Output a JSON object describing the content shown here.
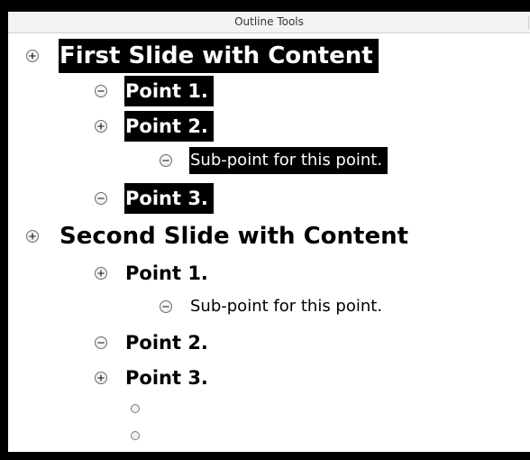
{
  "toolbar": {
    "title": "Outline Tools"
  },
  "outline": [
    {
      "text": "First Slide with Content",
      "level": 1,
      "toggle": "expand",
      "selected": true
    },
    {
      "text": "Point 1.",
      "level": 2,
      "toggle": "collapse",
      "selected": true
    },
    {
      "text": "Point 2.",
      "level": 2,
      "toggle": "expand",
      "selected": true
    },
    {
      "text": "Sub-point for this point.",
      "level": 3,
      "toggle": "collapse",
      "selected": true
    },
    {
      "text": "Point 3.",
      "level": 2,
      "toggle": "collapse",
      "selected": true
    },
    {
      "text": "Second Slide with Content",
      "level": 1,
      "toggle": "expand",
      "selected": false
    },
    {
      "text": "Point 1.",
      "level": 2,
      "toggle": "expand",
      "selected": false
    },
    {
      "text": "Sub-point for this point.",
      "level": 3,
      "toggle": "collapse",
      "selected": false
    },
    {
      "text": "Point 2.",
      "level": 2,
      "toggle": "collapse",
      "selected": false
    },
    {
      "text": "Point 3.",
      "level": 2,
      "toggle": "expand",
      "selected": false
    },
    {
      "text": "",
      "level": 3,
      "toggle": "empty",
      "selected": false
    },
    {
      "text": "",
      "level": 3,
      "toggle": "empty",
      "selected": false
    }
  ],
  "icons": {
    "expand": "plus-circle-icon",
    "collapse": "minus-circle-icon",
    "empty": "empty-bullet-icon"
  },
  "colors": {
    "selection": "#000000",
    "selected_text": "#ffffff",
    "toolbar_bg": "#f3f3f3",
    "frame": "#000000"
  }
}
